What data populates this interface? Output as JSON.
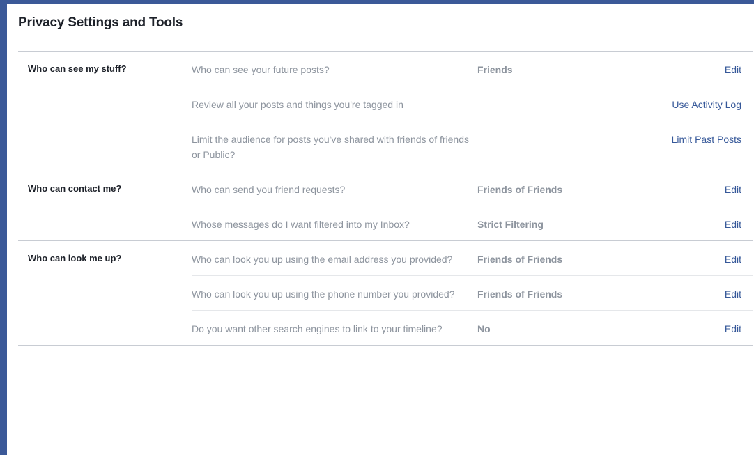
{
  "page": {
    "title": "Privacy Settings and Tools"
  },
  "sections": [
    {
      "label": "Who can see my stuff?",
      "rows": [
        {
          "question": "Who can see your future posts?",
          "value": "Friends",
          "action": "Edit"
        },
        {
          "question": "Review all your posts and things you're tagged in",
          "value": "",
          "action": "Use Activity Log"
        },
        {
          "question": "Limit the audience for posts you've shared with friends of friends or Public?",
          "value": "",
          "action": "Limit Past Posts"
        }
      ]
    },
    {
      "label": "Who can contact me?",
      "rows": [
        {
          "question": "Who can send you friend requests?",
          "value": "Friends of Friends",
          "action": "Edit"
        },
        {
          "question": "Whose messages do I want filtered into my Inbox?",
          "value": "Strict Filtering",
          "action": "Edit"
        }
      ]
    },
    {
      "label": "Who can look me up?",
      "rows": [
        {
          "question": "Who can look you up using the email address you provided?",
          "value": "Friends of Friends",
          "action": "Edit"
        },
        {
          "question": "Who can look you up using the phone number you provided?",
          "value": "Friends of Friends",
          "action": "Edit"
        },
        {
          "question": "Do you want other search engines to link to your timeline?",
          "value": "No",
          "action": "Edit"
        }
      ]
    }
  ],
  "colors": {
    "frame": "#3b5998",
    "link": "#365899",
    "muted": "#8d949e",
    "heading": "#1d2129"
  }
}
